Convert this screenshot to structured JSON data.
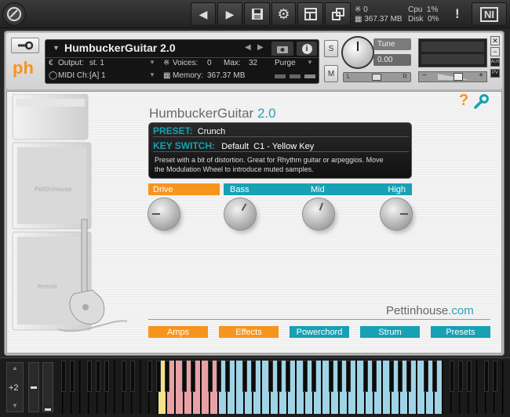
{
  "topbar": {
    "voices": "0",
    "memory": "367.37 MB",
    "cpu_label": "Cpu",
    "cpu_value": "1%",
    "disk_label": "Disk",
    "disk_value": "0%",
    "warning": "!",
    "logo": "NI"
  },
  "header": {
    "logo_text": "ph",
    "instrument_name": "HumbuckerGuitar 2.0",
    "output_label": "Output:",
    "output_value": "st. 1",
    "voices_label": "Voices:",
    "voices_value": "0",
    "max_label": "Max:",
    "max_value": "32",
    "purge_label": "Purge",
    "midi_label": "MIDI Ch:",
    "midi_value": "[A] 1",
    "memory_label": "Memory:",
    "memory_value": "367.37 MB",
    "s_label": "S",
    "m_label": "M",
    "tune_label": "Tune",
    "tune_value": "0.00",
    "pan_left": "L",
    "pan_right": "R",
    "aux_label": "AUX",
    "pv_label": "PV"
  },
  "panel": {
    "title_main": "HumbuckerGuitar",
    "title_version": "2.0",
    "help_icon": "?",
    "preset_label": "PRESET:",
    "preset_value": "Crunch",
    "keyswitch_label": "KEY SWITCH:",
    "keyswitch_value": "Default  C1 - Yellow Key",
    "description_line1": "Preset with a bit of distortion. Great for Rhythm guitar or arpeggios. Move",
    "description_line2": "the Modulation Wheel to introduce muted samples.",
    "knobs": {
      "drive": "Drive",
      "bass": "Bass",
      "mid": "Mid",
      "high": "High"
    },
    "brand_main": "Pettinhouse",
    "brand_suffix": ".com",
    "nav": {
      "amps": "Amps",
      "effects": "Effects",
      "powerchord": "Powerchord",
      "strum": "Strum",
      "presets": "Presets"
    }
  },
  "keyboard": {
    "octave": "+2"
  },
  "colors": {
    "orange": "#f7941d",
    "teal": "#18a0b4",
    "keyswitch_yellow": "#f2e38a",
    "keyswitch_red": "#e8a1a6",
    "playable_blue": "#9fd4e6"
  }
}
